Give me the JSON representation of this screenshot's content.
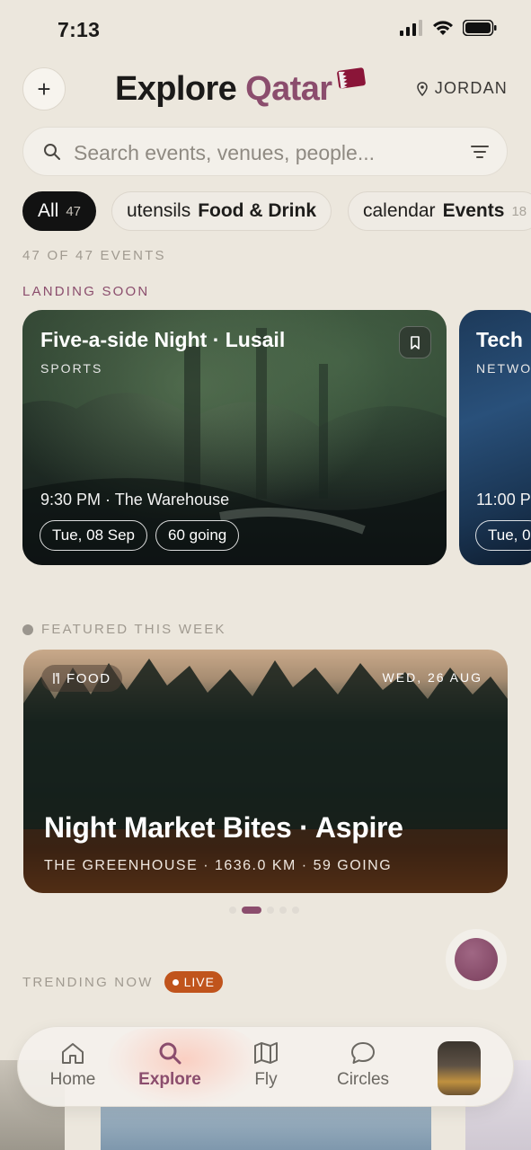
{
  "status": {
    "time": "7:13"
  },
  "header": {
    "title_prefix": "Explore",
    "title_accent": "Qatar",
    "location": "JORDAN"
  },
  "search": {
    "placeholder": "Search events, venues, people..."
  },
  "filters": [
    {
      "label": "All",
      "count": "47",
      "active": true
    },
    {
      "prefix": "utensils",
      "label": "Food & Drink"
    },
    {
      "prefix": "calendar",
      "label": "Events",
      "count": "18"
    }
  ],
  "events_count": "47 OF 47 EVENTS",
  "landing": {
    "section_label": "LANDING SOON",
    "cards": [
      {
        "title": "Five-a-side Night · Lusail",
        "category": "SPORTS",
        "time": "9:30 PM · The Warehouse",
        "date": "Tue, 08 Sep",
        "going": "60 going"
      },
      {
        "title": "Tech",
        "category": "NETWOR",
        "time": "11:00 P",
        "date": "Tue, 0"
      }
    ]
  },
  "featured": {
    "section_label": "FEATURED THIS WEEK",
    "category": "FOOD",
    "date": "WED, 26 AUG",
    "title": "Night Market Bites · Aspire",
    "subtitle": "THE GREENHOUSE · 1636.0 KM · 59 GOING"
  },
  "trending": {
    "label": "TRENDING NOW",
    "badge": "LIVE"
  },
  "tabs": [
    {
      "label": "Home",
      "icon": "home-icon"
    },
    {
      "label": "Explore",
      "icon": "search-icon",
      "active": true
    },
    {
      "label": "Fly",
      "icon": "map-icon"
    },
    {
      "label": "Circles",
      "icon": "chat-bubble-icon"
    }
  ],
  "colors": {
    "accent": "#8b4d6d",
    "live": "#c0541c",
    "background": "#ece7dd"
  }
}
